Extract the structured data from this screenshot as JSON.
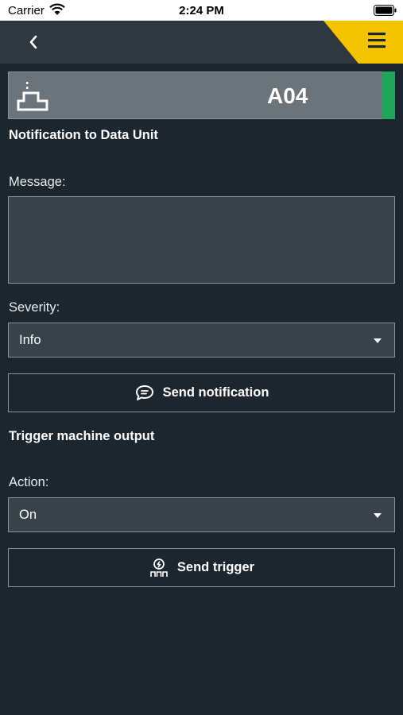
{
  "status_bar": {
    "carrier": "Carrier",
    "time": "2:24 PM"
  },
  "nav": {
    "back_icon": "chevron-left-icon",
    "menu_icon": "hamburger-menu-icon",
    "accent_color": "#f5c400"
  },
  "machine": {
    "id": "A04",
    "icon": "machine-icon",
    "status_color": "#20a55a"
  },
  "notification": {
    "title": "Notification to Data Unit",
    "message_label": "Message:",
    "message_value": "",
    "severity_label": "Severity:",
    "severity_value": "Info",
    "send_label": "Send notification",
    "send_icon": "chat-bubble-icon"
  },
  "trigger": {
    "title": "Trigger machine output",
    "action_label": "Action:",
    "action_value": "On",
    "send_label": "Send trigger",
    "send_icon": "trigger-icon"
  }
}
